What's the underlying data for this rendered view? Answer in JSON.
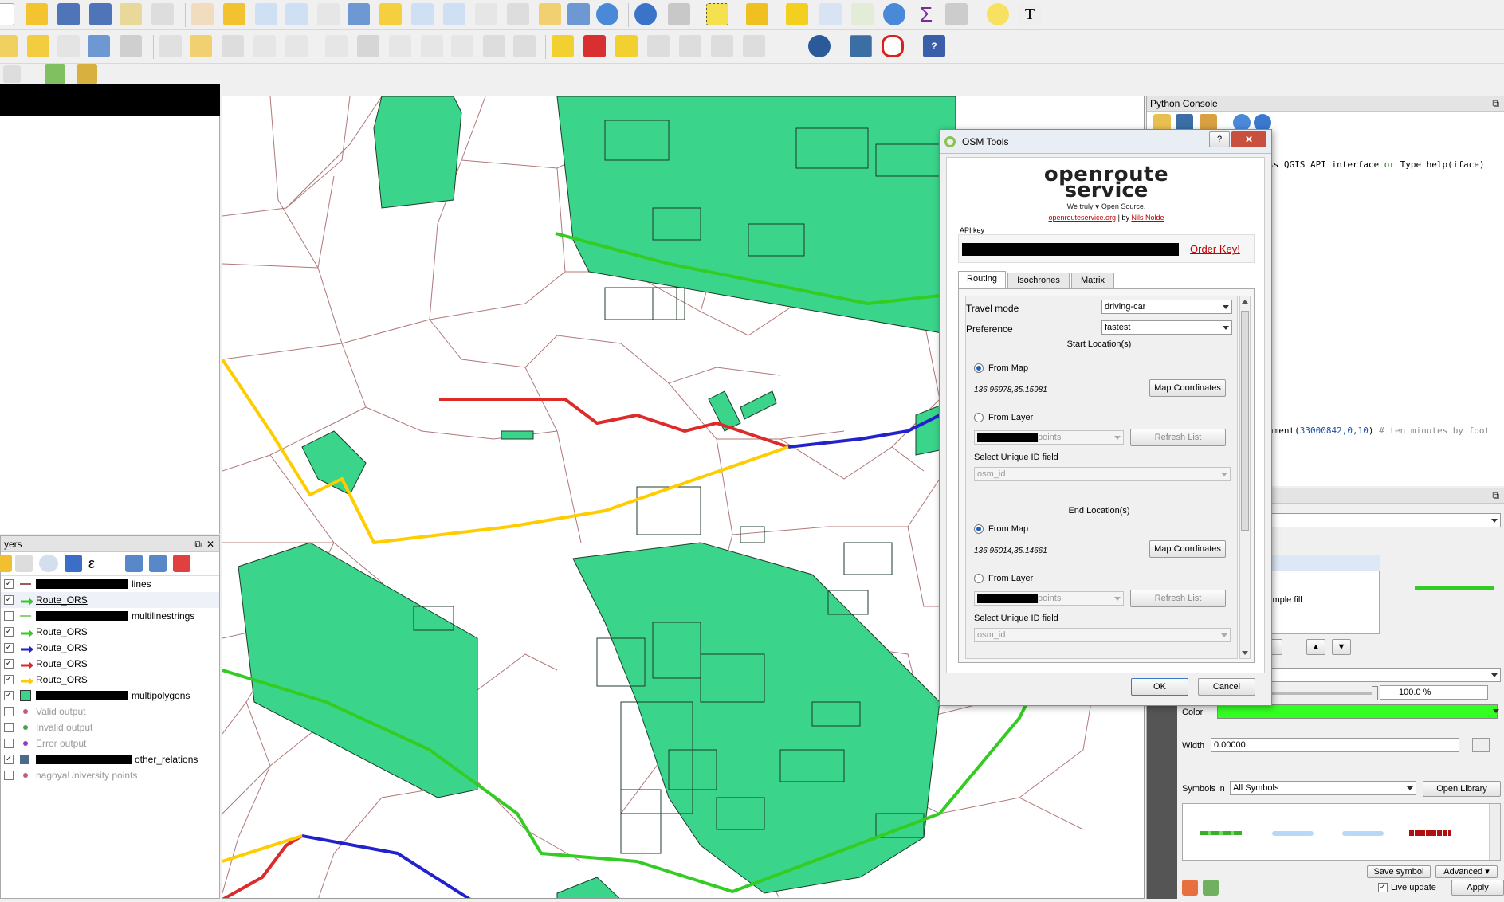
{
  "dialog": {
    "title": "OSM Tools",
    "help_button": "?",
    "close_button": "✕",
    "brand_line1": "openroute",
    "brand_line2": "service",
    "tagline": "We truly ♥ Open Source.",
    "link_ors": "openrouteservice.org",
    "by_text": "| by",
    "link_author": "Nils Nolde",
    "api_key_label": "API key",
    "order_key": "Order Key!",
    "tabs": [
      "Routing",
      "Isochrones",
      "Matrix"
    ],
    "travel_mode_label": "Travel mode",
    "travel_mode_value": "driving-car",
    "preference_label": "Preference",
    "preference_value": "fastest",
    "start_header": "Start Location(s)",
    "end_header": "End Location(s)",
    "from_map": "From Map",
    "from_layer": "From Layer",
    "start_coords": "136.96978,35.15981",
    "end_coords": "136.95014,35.14661",
    "map_coords_btn": "Map Coordinates",
    "layer_suffix": "points",
    "refresh_btn": "Refresh List",
    "unique_id_label": "Select Unique ID field",
    "unique_id_value": "osm_id",
    "ok": "OK",
    "cancel": "Cancel"
  },
  "python_console": {
    "title": "Python Console",
    "line1_parts": [
      "ss QGIS API interface ",
      "or",
      " Type help(iface)"
    ],
    "line2_parts": [
      "hment(",
      "33000842,0,10",
      ") ",
      "# ten minutes by foot"
    ]
  },
  "layers_panel": {
    "title": "yers",
    "items": [
      {
        "label": "lines",
        "checked": true,
        "redacted": true,
        "symbol": "line-dark"
      },
      {
        "label": "Route_ORS",
        "checked": true,
        "redacted": false,
        "symbol": "arrow-green",
        "underline": true
      },
      {
        "label": "multilinestrings",
        "checked": false,
        "redacted": true,
        "symbol": "line-green"
      },
      {
        "label": "Route_ORS",
        "checked": true,
        "redacted": false,
        "symbol": "arrow-green"
      },
      {
        "label": "Route_ORS",
        "checked": true,
        "redacted": false,
        "symbol": "arrow-blue"
      },
      {
        "label": "Route_ORS",
        "checked": true,
        "redacted": false,
        "symbol": "arrow-red"
      },
      {
        "label": "Route_ORS",
        "checked": true,
        "redacted": false,
        "symbol": "arrow-yellow"
      },
      {
        "label": "multipolygons",
        "checked": true,
        "redacted": true,
        "symbol": "fill-green"
      },
      {
        "label": "Valid output",
        "checked": false,
        "redacted": false,
        "symbol": "dot-pink",
        "grey": true
      },
      {
        "label": "Invalid output",
        "checked": false,
        "redacted": false,
        "symbol": "dot-green",
        "grey": true
      },
      {
        "label": "Error output",
        "checked": false,
        "redacted": false,
        "symbol": "dot-purple",
        "grey": true
      },
      {
        "label": "other_relations",
        "checked": true,
        "redacted": true,
        "symbol": "raster"
      },
      {
        "label": "nagoyaUniversity points",
        "checked": false,
        "redacted": false,
        "symbol": "dot-pink",
        "grey": true
      }
    ]
  },
  "style_panel": {
    "simple_fill": "imple fill",
    "opacity_value": "100.0 %",
    "color_label": "Color",
    "width_label": "Width",
    "width_value": "0.00000",
    "symbols_in_label": "Symbols in",
    "symbols_in_value": "All Symbols",
    "open_library": "Open Library",
    "save_symbol": "Save symbol",
    "advanced": "Advanced ▾",
    "live_update": "Live update",
    "apply": "Apply"
  },
  "colors": {
    "route_green": "#33cc22",
    "route_blue": "#2222cc",
    "route_red": "#dd2a2a",
    "route_yellow": "#ffcc00",
    "polygon_fill": "#3ad48a",
    "street": "#b0787a",
    "accent_link": "#c00000"
  }
}
